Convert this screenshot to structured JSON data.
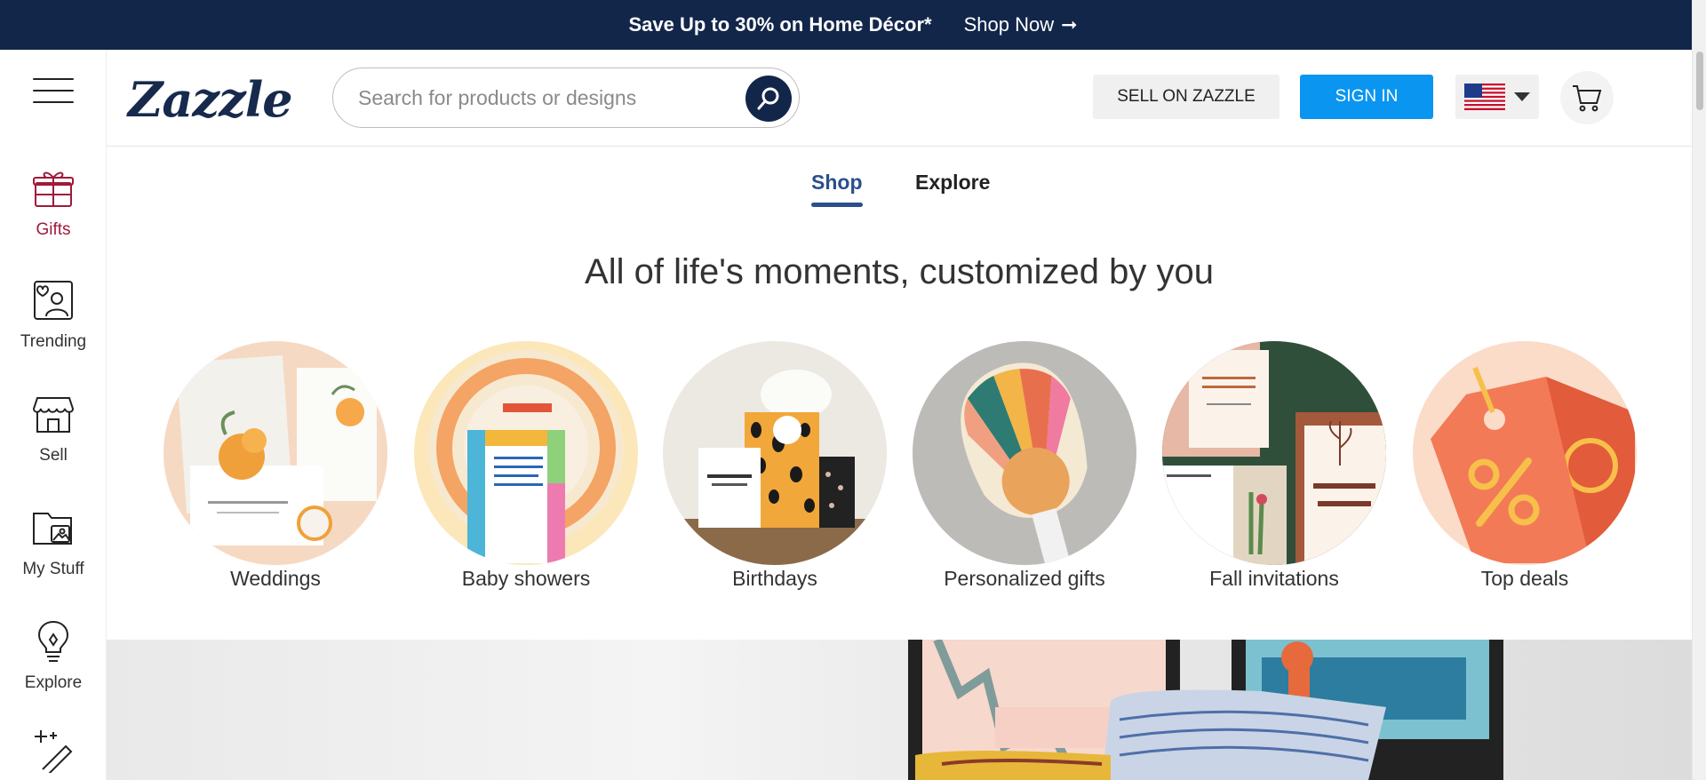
{
  "promo": {
    "text": "Save Up to 30% on Home Décor*",
    "cta": "Shop Now"
  },
  "header": {
    "logo": "Zazzle",
    "search_placeholder": "Search for products or designs",
    "sell_label": "SELL ON ZAZZLE",
    "signin_label": "SIGN IN"
  },
  "rail": {
    "items": [
      {
        "label": "Gifts",
        "icon": "gift-icon"
      },
      {
        "label": "Trending",
        "icon": "trending-icon"
      },
      {
        "label": "Sell",
        "icon": "store-icon"
      },
      {
        "label": "My Stuff",
        "icon": "folder-icon"
      },
      {
        "label": "Explore",
        "icon": "lightbulb-icon"
      }
    ]
  },
  "tabs": [
    {
      "label": "Shop"
    },
    {
      "label": "Explore"
    }
  ],
  "headline": "All of life's moments, customized by you",
  "categories": [
    {
      "label": "Weddings"
    },
    {
      "label": "Baby showers"
    },
    {
      "label": "Birthdays"
    },
    {
      "label": "Personalized gifts"
    },
    {
      "label": "Fall invitations"
    },
    {
      "label": "Top deals"
    }
  ],
  "colors": {
    "navy": "#12264a",
    "accent_blue": "#0a96f0",
    "gift_red": "#a01a3a"
  }
}
